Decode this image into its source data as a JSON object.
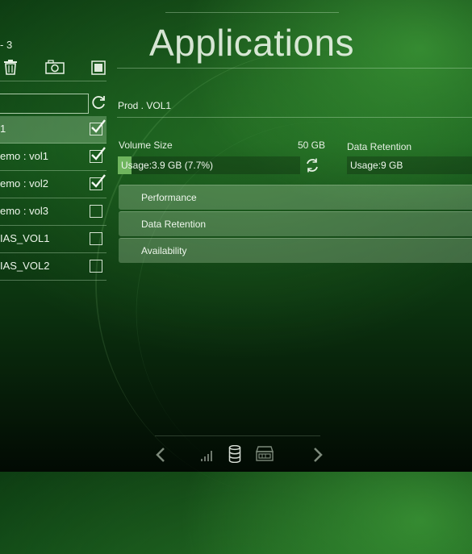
{
  "header": {
    "title": "Applications"
  },
  "sidebar": {
    "count_label": "- 3",
    "search": {
      "value": ""
    },
    "volumes": [
      {
        "label": "1",
        "checked": true,
        "selected": true
      },
      {
        "label": "emo : vol1",
        "checked": true,
        "selected": false
      },
      {
        "label": "emo : vol2",
        "checked": true,
        "selected": false
      },
      {
        "label": "emo : vol3",
        "checked": false,
        "selected": false
      },
      {
        "label": "IAS_VOL1",
        "checked": false,
        "selected": false
      },
      {
        "label": "IAS_VOL2",
        "checked": false,
        "selected": false
      }
    ]
  },
  "detail": {
    "title": "Prod . VOL1",
    "volume_size_label": "Volume Size",
    "volume_size_value": "50 GB",
    "volume_usage_text": "Usage:3.9 GB (7.7%)",
    "volume_usage_fraction": 0.077,
    "data_retention_label": "Data Retention",
    "data_retention_usage_text": "Usage:9 GB",
    "sections": [
      {
        "label": "Performance"
      },
      {
        "label": "Data Retention"
      },
      {
        "label": "Availability"
      }
    ]
  },
  "icons": {
    "toolbar": [
      "trash-icon",
      "camera-icon",
      "stop-icon"
    ],
    "bottom_nav": [
      "chevron-left-icon",
      "signal-bars-icon",
      "database-icon",
      "server-icon",
      "chevron-right-icon"
    ]
  },
  "colors": {
    "accent": "#6fb55e",
    "background": "#14521a"
  }
}
